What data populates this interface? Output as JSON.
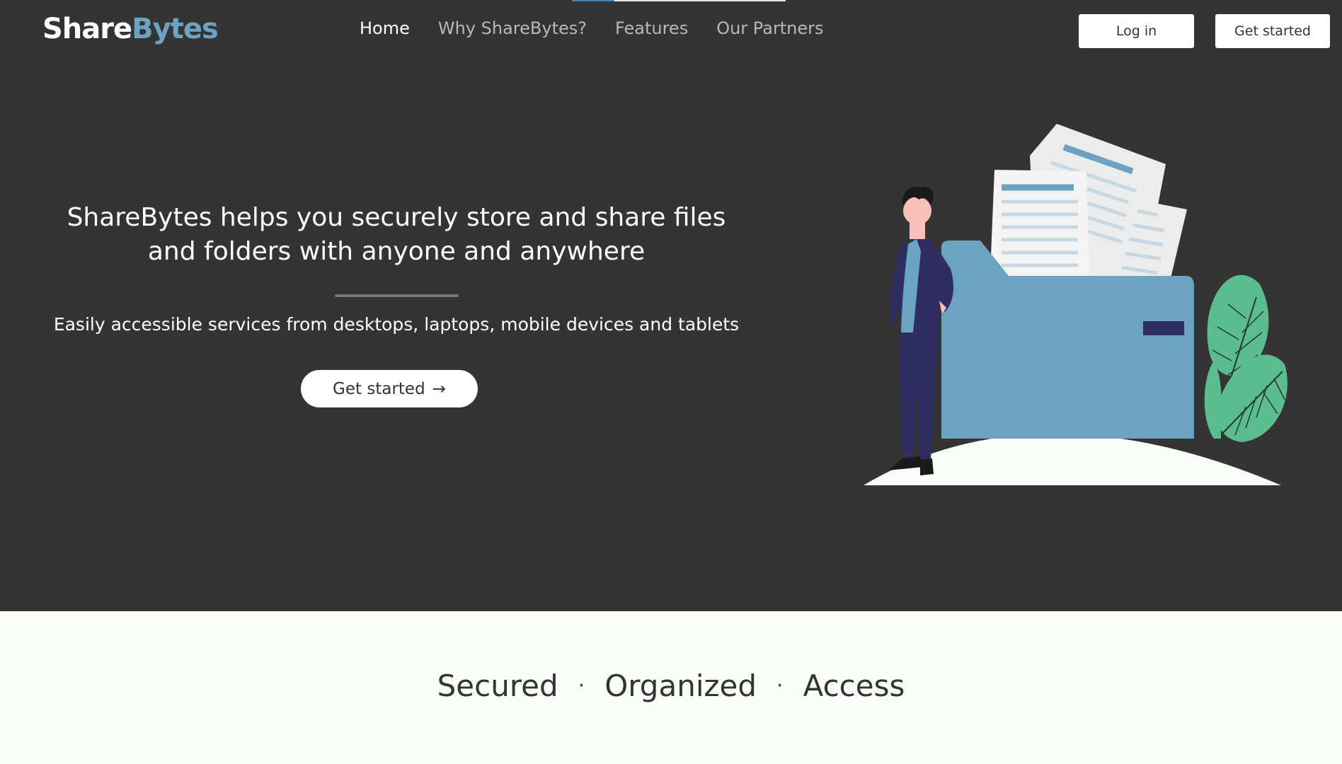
{
  "brand": {
    "part1": "Share",
    "part2": "Bytes"
  },
  "nav": {
    "items": [
      {
        "label": "Home",
        "active": true
      },
      {
        "label": "Why ShareBytes?",
        "active": false
      },
      {
        "label": "Features",
        "active": false
      },
      {
        "label": "Our Partners",
        "active": false
      }
    ]
  },
  "header_buttons": {
    "login": "Log in",
    "get_started": "Get started"
  },
  "hero": {
    "headline_line1": "ShareBytes helps you securely store and share files",
    "headline_line2": "and folders with anyone and anywhere",
    "subline": "Easily accessible services from desktops, laptops, mobile devices and tablets",
    "cta_label": "Get started",
    "cta_arrow": "→",
    "illustration_icon": "person-with-folder-illustration"
  },
  "tagline": {
    "items": [
      "Secured",
      "Organized",
      "Access"
    ],
    "separator": "·"
  },
  "colors": {
    "hero_bg": "#343434",
    "page_bg": "#f8fdf7",
    "accent_blue": "#6ba3c0",
    "leaf_green": "#5bbd8f",
    "suit_navy": "#2f2d62"
  }
}
